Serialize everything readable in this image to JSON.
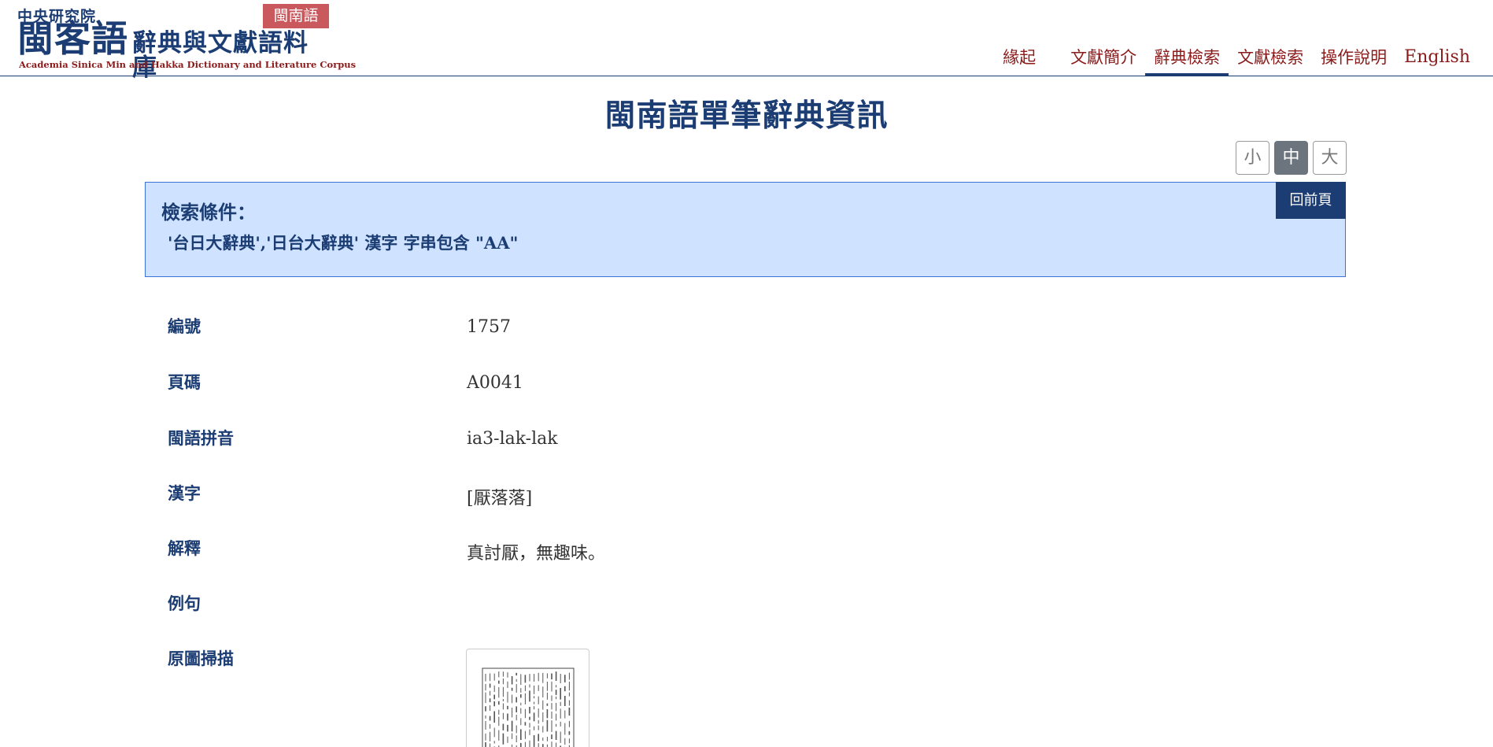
{
  "header": {
    "logo_top": "中央研究院",
    "logo_main": "閩客語",
    "logo_sub": "辭典與文獻語料庫",
    "logo_en": "Academia Sinica Min and Hakka Dictionary and Literature Corpus",
    "lang_badge": "閩南語",
    "nav": [
      {
        "label": "緣起",
        "active": false
      },
      {
        "label": "文獻簡介",
        "active": false
      },
      {
        "label": "辭典檢索",
        "active": true
      },
      {
        "label": "文獻檢索",
        "active": false
      },
      {
        "label": "操作說明",
        "active": false
      },
      {
        "label": "English",
        "active": false
      }
    ]
  },
  "page_title": "閩南語單筆辭典資訊",
  "font_size_buttons": [
    {
      "label": "小",
      "active": false
    },
    {
      "label": "中",
      "active": true
    },
    {
      "label": "大",
      "active": false
    }
  ],
  "search_condition": {
    "label": "檢索條件：",
    "text": "'台日大辭典','日台大辭典' 漢字 字串包含 \"AA\"",
    "back_button": "回前頁"
  },
  "details": [
    {
      "label": "編號",
      "value": "1757"
    },
    {
      "label": "頁碼",
      "value": "A0041"
    },
    {
      "label": "閩語拼音",
      "value": "ia3-lak-lak"
    },
    {
      "label": "漢字",
      "value": "[厭落落]"
    },
    {
      "label": "解釋",
      "value": "真討厭，無趣味。"
    },
    {
      "label": "例句",
      "value": ""
    },
    {
      "label": "原圖掃描",
      "value": ""
    }
  ],
  "colors": {
    "brand_blue": "#1b3d73",
    "nav_red": "#8b1a1a",
    "badge_red": "#c9595d",
    "cond_bg": "#cfe2ff"
  }
}
